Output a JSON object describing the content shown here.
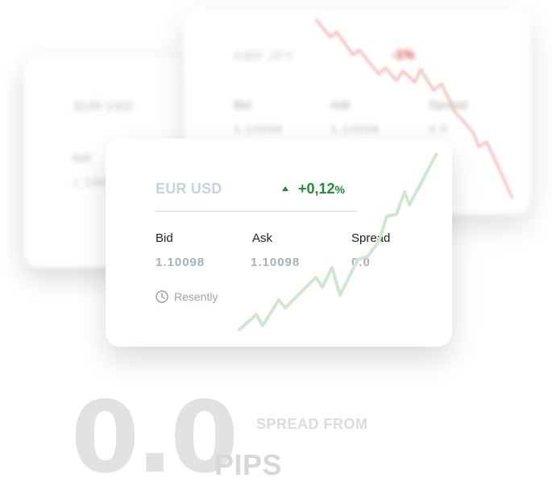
{
  "cards": {
    "back_left": {
      "pair": "EUR USD",
      "labels": {
        "bid": "Bid"
      },
      "values": {
        "bid": "1.10098"
      }
    },
    "back_right": {
      "pair": "GBP JPY",
      "change": "-1%",
      "labels": {
        "bid": "Bid",
        "ask": "Ask",
        "spread": "Spread"
      },
      "values": {
        "bid": "1.10098",
        "ask": "1.10098",
        "spread": "0.0"
      }
    },
    "front": {
      "pair": "EUR USD",
      "change": "+0,12",
      "change_unit": "%",
      "labels": {
        "bid": "Bid",
        "ask": "Ask",
        "spread": "Spread"
      },
      "values": {
        "bid": "1.10098",
        "ask": "1.10098",
        "spread": "0.0"
      },
      "recent_label": "Resently"
    }
  },
  "hero": {
    "big_value": "0.0",
    "caption_top": "SPREAD FROM",
    "caption_bottom": "PIPS"
  },
  "colors": {
    "up": "#1e8b3a",
    "down": "#d23c3c",
    "up_line": "#cfe6d4",
    "down_line": "#f3b9b9"
  },
  "icons": {
    "recent": "clock-icon",
    "trend_up": "triangle-up-icon"
  }
}
